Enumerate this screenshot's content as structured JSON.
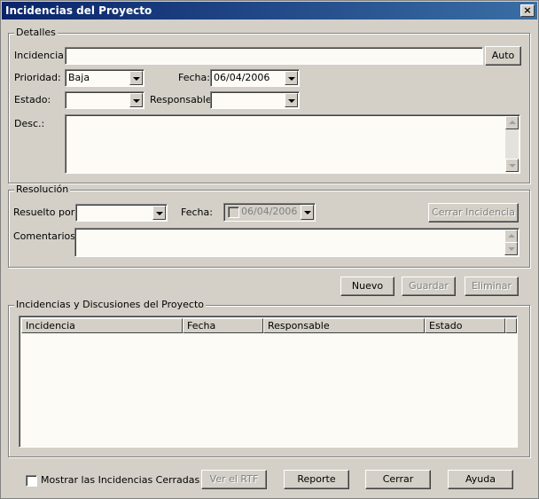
{
  "window": {
    "title": "Incidencias del Proyecto",
    "close_glyph": "×"
  },
  "detalles": {
    "legend": "Detalles",
    "incidencia_label": "Incidencia:",
    "incidencia_value": "",
    "auto_button": "Auto",
    "prioridad_label": "Prioridad:",
    "prioridad_value": "Baja",
    "fecha_label": "Fecha:",
    "fecha_value": "06/04/2006",
    "estado_label": "Estado:",
    "estado_value": "",
    "responsable_label": "Responsable:",
    "responsable_value": "",
    "desc_label": "Desc.:",
    "desc_value": ""
  },
  "resolucion": {
    "legend": "Resolución",
    "resuelto_label": "Resuelto por:",
    "resuelto_value": "",
    "fecha_label": "Fecha:",
    "fecha_value": "06/04/2006",
    "cerrar_incidencia_button": "Cerrar Incidencia",
    "comentarios_label": "Comentarios:",
    "comentarios_value": ""
  },
  "actions": {
    "nuevo": "Nuevo",
    "guardar": "Guardar",
    "eliminar": "Eliminar"
  },
  "list": {
    "legend": "Incidencias y Discusiones del Proyecto",
    "columns": [
      "Incidencia",
      "Fecha",
      "Responsable",
      "Estado"
    ],
    "rows": []
  },
  "footer": {
    "mostrar_cerradas_label": "Mostrar las Incidencias Cerradas",
    "ver_rtf": "Ver el RTF",
    "reporte": "Reporte",
    "cerrar": "Cerrar",
    "ayuda": "Ayuda"
  },
  "icons": {
    "dropdown": "chevron-down-icon",
    "scroll_up": "arrow-up-icon",
    "scroll_down": "arrow-down-icon",
    "close": "close-icon"
  }
}
